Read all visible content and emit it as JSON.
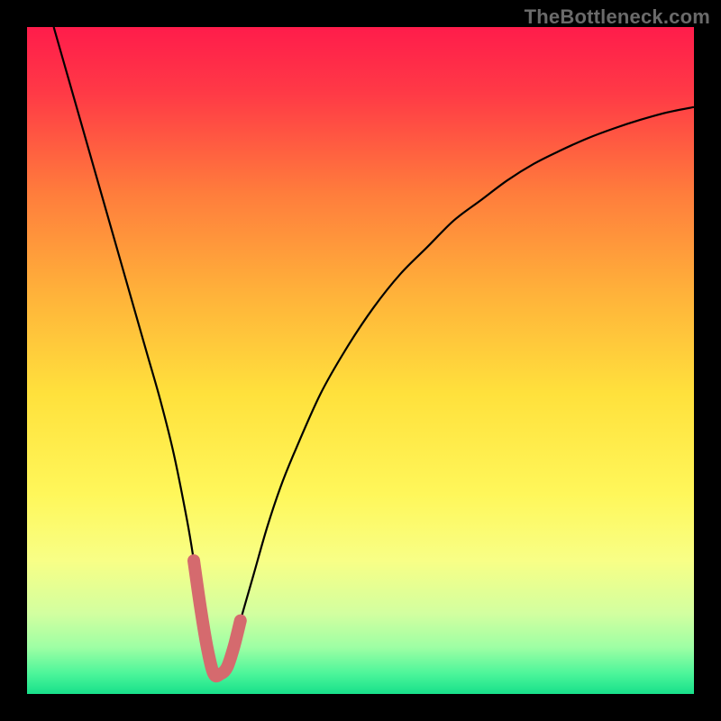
{
  "watermark": "TheBottleneck.com",
  "chart_data": {
    "type": "line",
    "title": "",
    "xlabel": "",
    "ylabel": "",
    "xlim": [
      0,
      100
    ],
    "ylim": [
      0,
      100
    ],
    "legend": false,
    "grid": false,
    "background_gradient": {
      "stops": [
        {
          "offset": 0.0,
          "color": "#ff1c4b"
        },
        {
          "offset": 0.1,
          "color": "#ff3a46"
        },
        {
          "offset": 0.25,
          "color": "#ff7d3c"
        },
        {
          "offset": 0.4,
          "color": "#ffb23a"
        },
        {
          "offset": 0.55,
          "color": "#ffe13c"
        },
        {
          "offset": 0.7,
          "color": "#fff75a"
        },
        {
          "offset": 0.8,
          "color": "#f8ff86"
        },
        {
          "offset": 0.88,
          "color": "#d2ffa0"
        },
        {
          "offset": 0.93,
          "color": "#9effa4"
        },
        {
          "offset": 0.97,
          "color": "#4bf59a"
        },
        {
          "offset": 1.0,
          "color": "#18e08a"
        }
      ]
    },
    "series": [
      {
        "name": "bottleneck-curve",
        "color": "#000000",
        "stroke_width": 2.2,
        "x": [
          4,
          6,
          8,
          10,
          12,
          14,
          16,
          18,
          20,
          22,
          24,
          25,
          26,
          27,
          27.5,
          28,
          29,
          30,
          31,
          32,
          34,
          36,
          38,
          40,
          44,
          48,
          52,
          56,
          60,
          64,
          68,
          72,
          76,
          80,
          84,
          88,
          92,
          96,
          100
        ],
        "y": [
          100,
          93,
          86,
          79,
          72,
          65,
          58,
          51,
          44,
          36,
          26,
          20,
          13,
          7,
          4,
          3,
          3,
          4,
          7,
          11,
          18,
          25,
          31,
          36,
          45,
          52,
          58,
          63,
          67,
          71,
          74,
          77,
          79.5,
          81.5,
          83.3,
          84.8,
          86.1,
          87.2,
          88
        ]
      },
      {
        "name": "trough-highlight",
        "color": "#d56a6e",
        "stroke_width": 14,
        "linecap": "round",
        "x": [
          25,
          26,
          27,
          28,
          29,
          30,
          31,
          32
        ],
        "y": [
          20,
          13,
          7,
          3,
          3,
          4,
          7,
          11
        ]
      }
    ]
  }
}
